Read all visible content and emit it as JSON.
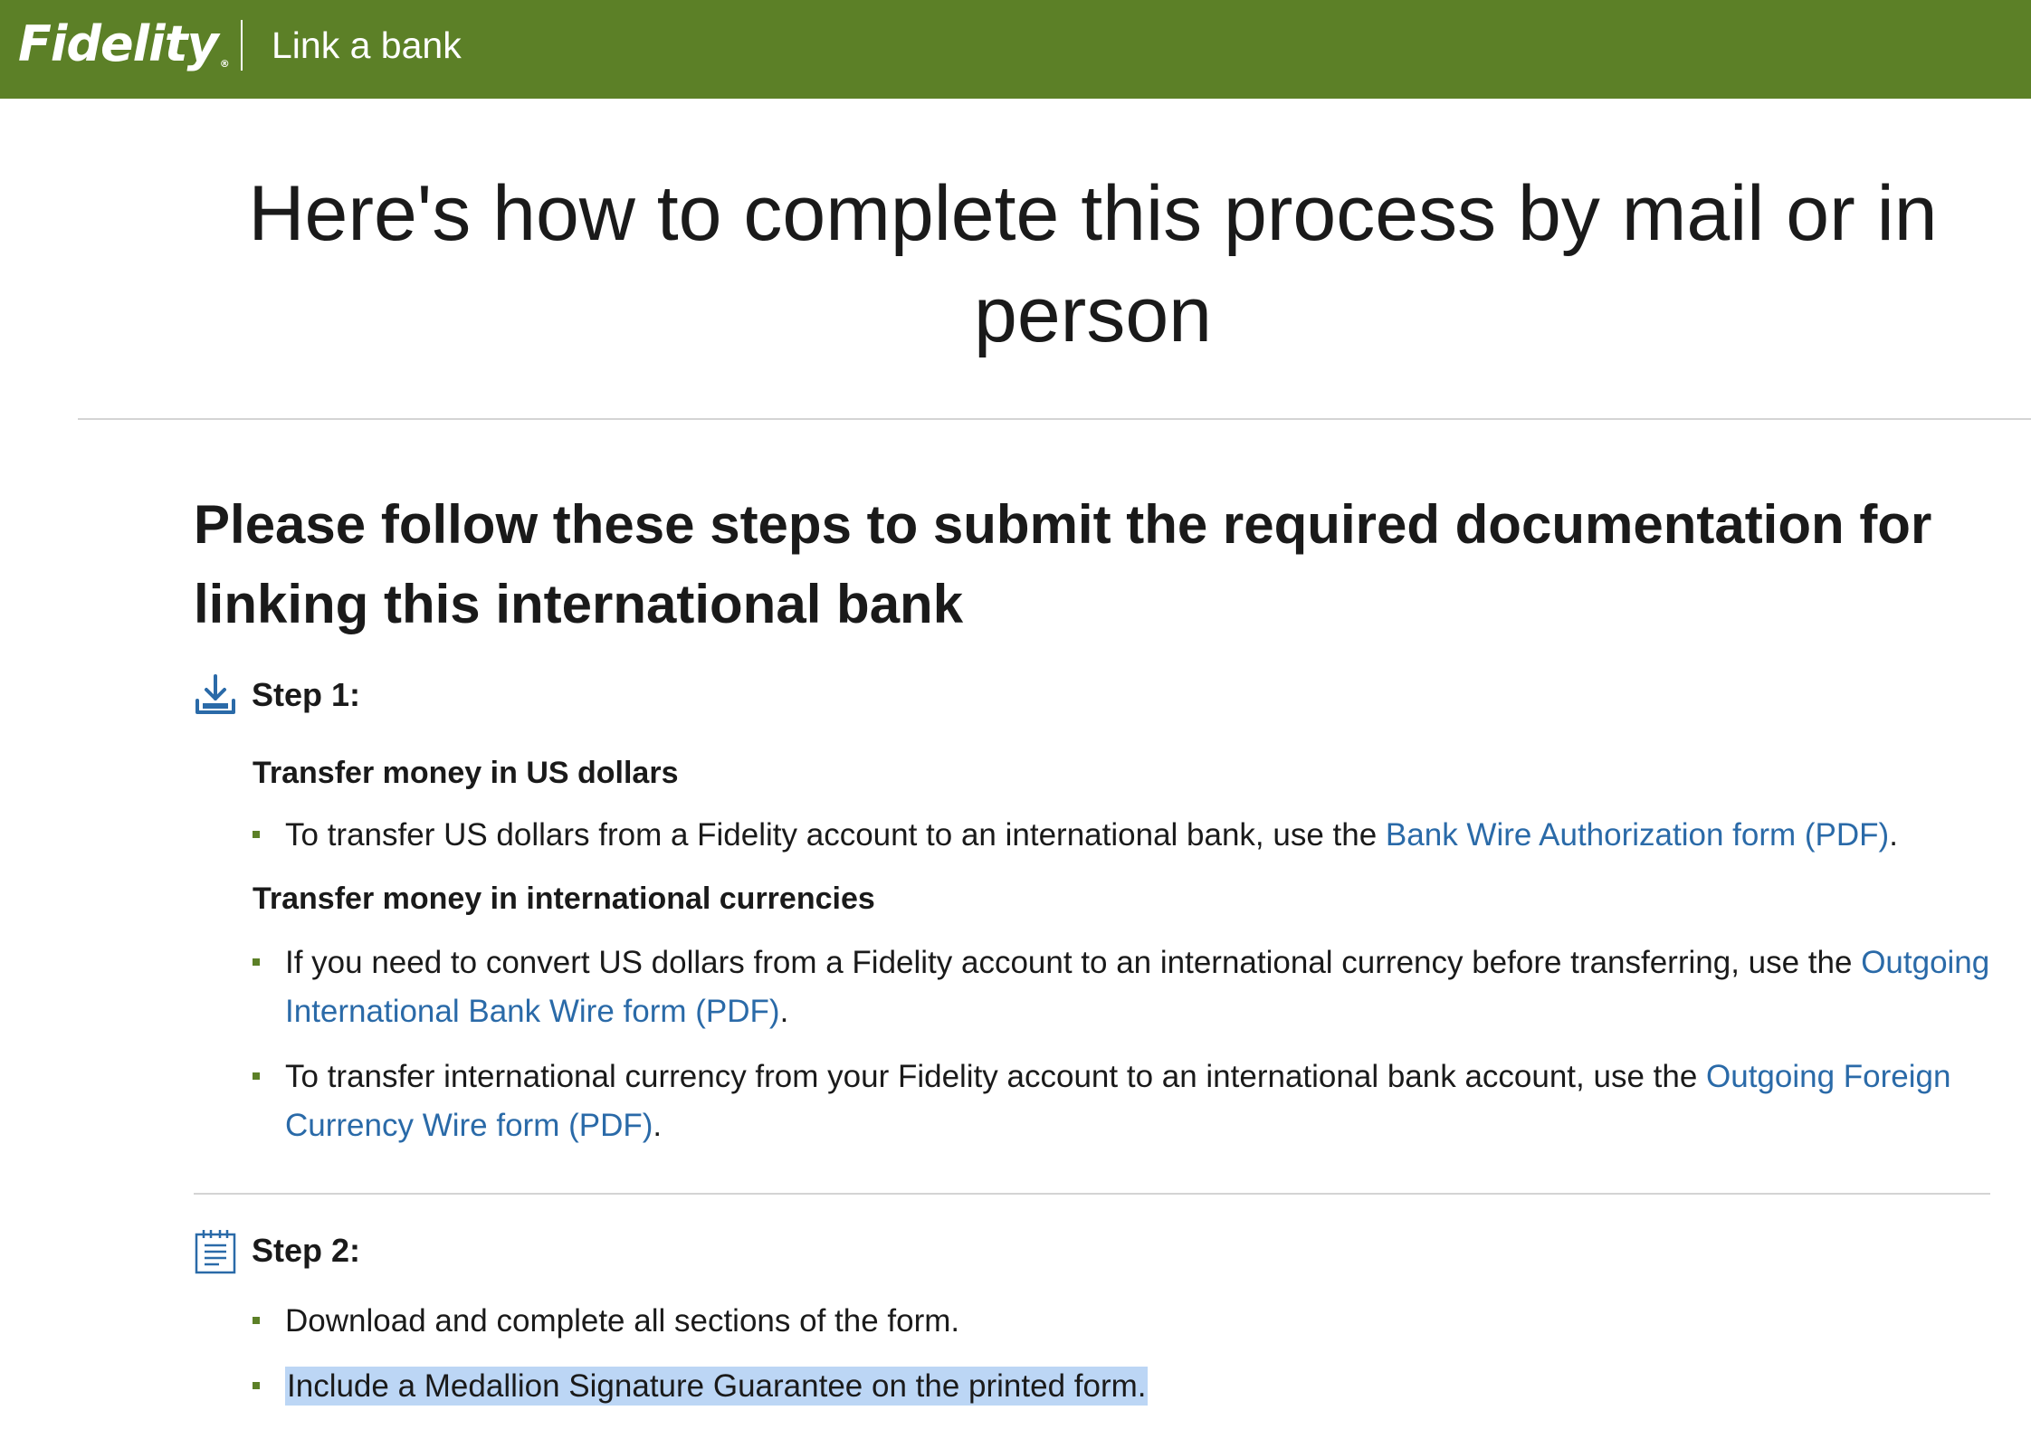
{
  "header": {
    "logo_text": "Fidelity",
    "logo_reg": "®",
    "title": "Link a bank"
  },
  "hero": {
    "title": "Here's how to complete this process by mail or in person"
  },
  "intro": {
    "text": "Please follow these steps to submit the required documentation for linking this international bank"
  },
  "step1": {
    "label": "Step 1:",
    "icon": "download-icon",
    "group1_title": "Transfer money in US dollars",
    "group1_bullet1_pre": "To transfer US dollars from a Fidelity account to an international bank, use the ",
    "group1_bullet1_link": "Bank Wire Authorization form (PDF)",
    "group1_bullet1_post": ".",
    "group2_title": "Transfer money in international currencies",
    "group2_bullet1_pre": "If you need to convert US dollars from a Fidelity account to an international currency before transferring, use the ",
    "group2_bullet1_link": "Outgoing International Bank Wire form (PDF)",
    "group2_bullet1_post": ".",
    "group2_bullet2_pre": "To transfer international currency from your Fidelity account to an international bank account, use the ",
    "group2_bullet2_link": "Outgoing Foreign Currency Wire form (PDF)",
    "group2_bullet2_post": "."
  },
  "step2": {
    "label": "Step 2:",
    "icon": "form-document-icon",
    "bullet1": "Download and complete all sections of the form.",
    "bullet2": "Include a Medallion Signature Guarantee on the printed form."
  },
  "colors": {
    "brand_green": "#5c8027",
    "link_blue": "#2a6aa8",
    "icon_blue": "#2a6aa8",
    "selection_highlight": "#bcd6f5"
  }
}
